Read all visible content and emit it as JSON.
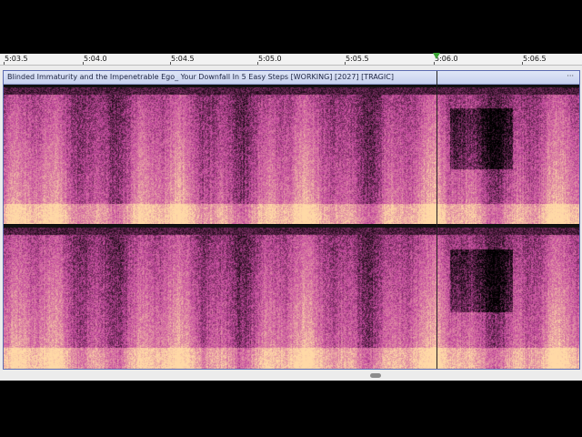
{
  "ruler": {
    "ticks": [
      "5:03.5",
      "5:04.0",
      "5:04.5",
      "5:05.0",
      "5:05.5",
      "5:06.0",
      "5:06.5"
    ]
  },
  "clip": {
    "title": "Blinded Immaturity and the Impenetrable Ego_ Your Downfall In 5 Easy Steps [WORKING] [2027] [TRAGIC]",
    "menu_label": "···"
  },
  "colors": {
    "clip_header": "#c7d1ee",
    "spectrogram_low": "#000000",
    "spectrogram_mid": "#c54aa0",
    "spectrogram_high": "#ffd9a6",
    "playhead": "#3aa535"
  },
  "icons": {
    "playhead": "triangle-down-icon",
    "clip_menu": "ellipsis-icon"
  }
}
